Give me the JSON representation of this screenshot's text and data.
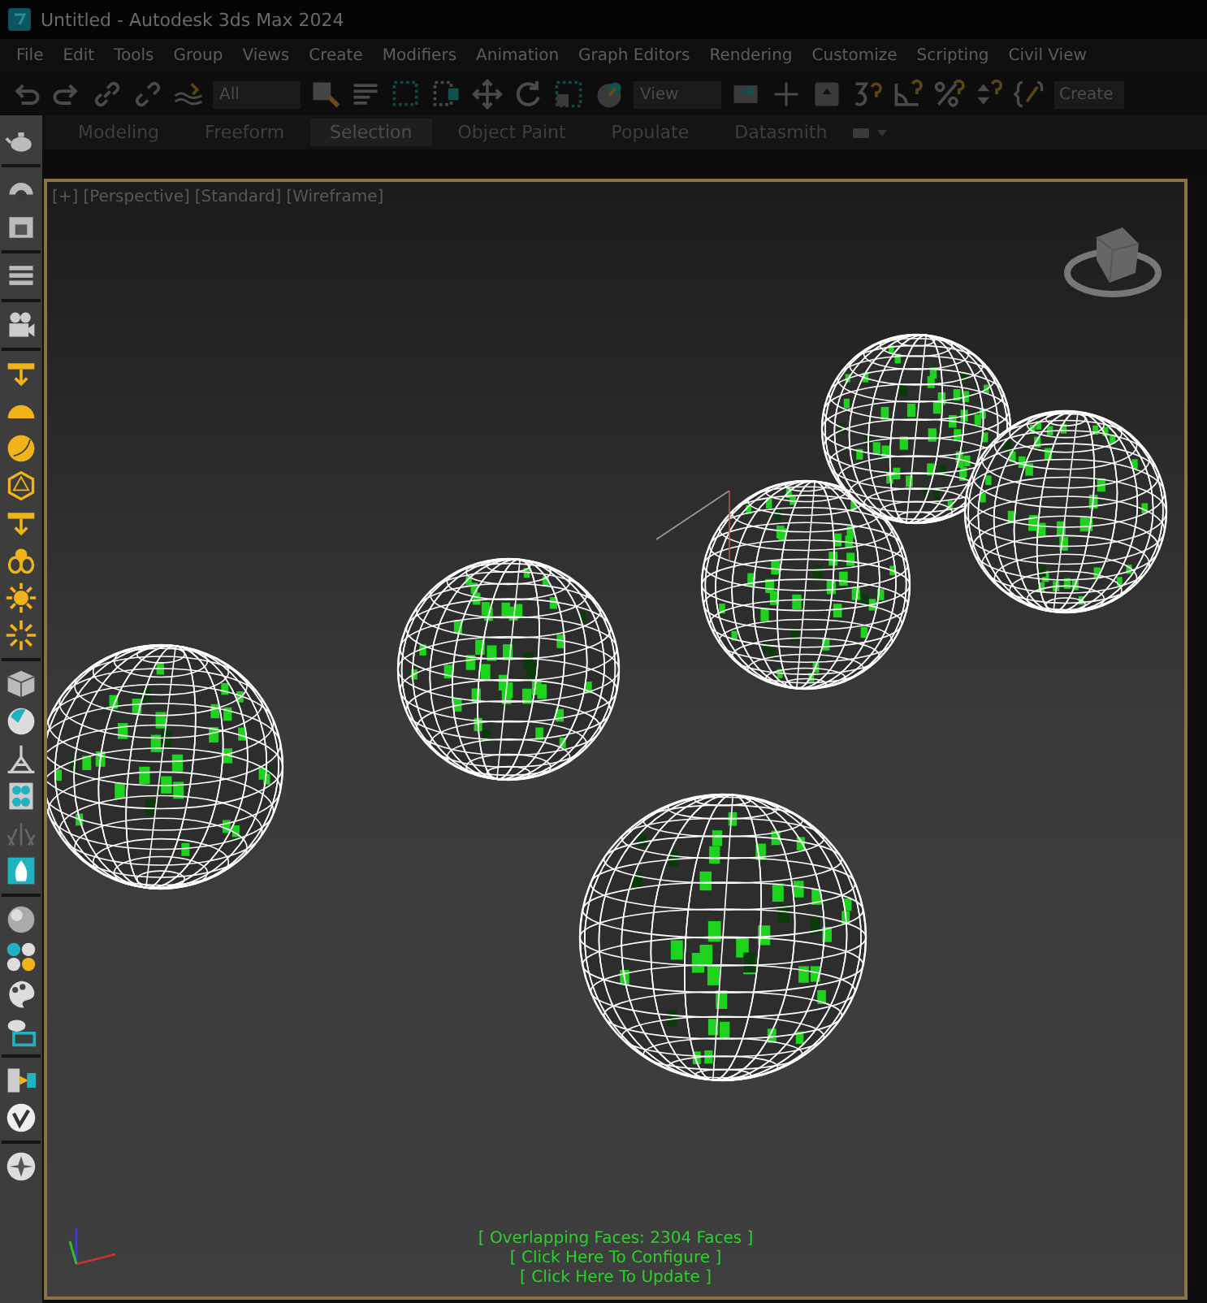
{
  "window": {
    "title": "Untitled - Autodesk 3ds Max 2024"
  },
  "menu": [
    "File",
    "Edit",
    "Tools",
    "Group",
    "Views",
    "Create",
    "Modifiers",
    "Animation",
    "Graph Editors",
    "Rendering",
    "Customize",
    "Scripting",
    "Civil View"
  ],
  "toolbar": {
    "selection_filter": "All",
    "reference_coordinate": "View",
    "named_selection": "Create"
  },
  "ribbon_tabs": [
    {
      "label": "Modeling",
      "selected": false
    },
    {
      "label": "Freeform",
      "selected": false
    },
    {
      "label": "Selection",
      "selected": true
    },
    {
      "label": "Object Paint",
      "selected": false
    },
    {
      "label": "Populate",
      "selected": false
    },
    {
      "label": "Datasmith",
      "selected": false
    }
  ],
  "viewport": {
    "labels": [
      "[+]",
      "[Perspective]",
      "[Standard]",
      "[Wireframe]"
    ],
    "messages": [
      "[ Overlapping Faces: 2304 Faces ]",
      "[ Click Here To Configure ]",
      "[ Click Here To Update ]"
    ]
  }
}
